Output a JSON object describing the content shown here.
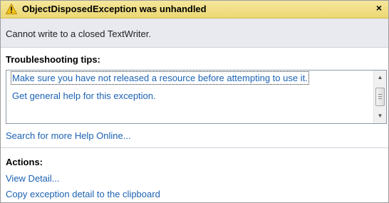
{
  "dialog": {
    "title": "ObjectDisposedException was unhandled",
    "close_glyph": "×",
    "icon": "warning-icon",
    "accent_color": "#ecd873"
  },
  "message": "Cannot write to a closed TextWriter.",
  "troubleshooting": {
    "heading": "Troubleshooting tips:",
    "tips": [
      "Make sure you have not released a resource before attempting to use it.",
      "Get general help for this exception."
    ]
  },
  "search_link": "Search for more Help Online...",
  "actions": {
    "heading": "Actions:",
    "items": [
      "View Detail...",
      "Copy exception detail to the clipboard"
    ]
  },
  "link_color": "#1b62b3"
}
